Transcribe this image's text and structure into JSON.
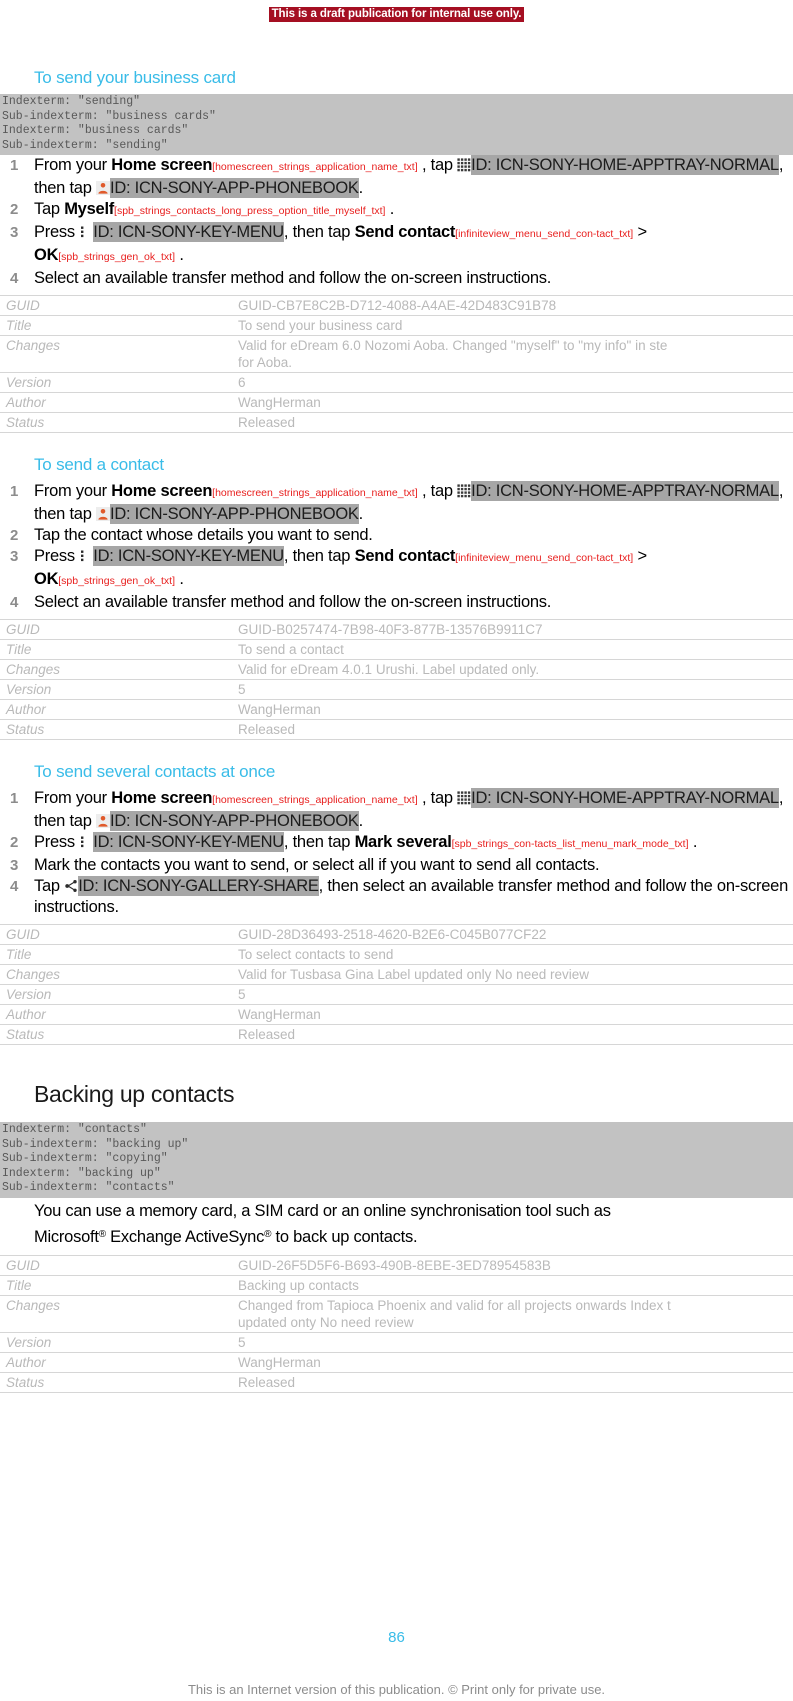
{
  "banner": {
    "text": "This is a draft publication for internal use only."
  },
  "colors": {
    "heading_blue": "#39bce8",
    "banner_red": "#a50f22",
    "token_red": "#e8201f",
    "idref_grey": "#a6a6a6",
    "indexblock_grey": "#c2c2c2",
    "meta_text_grey": "#b9b9b9"
  },
  "sections": [
    {
      "id": "send-business-card",
      "heading": "To send your business card",
      "indexterms": [
        "Indexterm: \"sending\"",
        "Sub-indexterm: \"business cards\"",
        "Indexterm: \"business cards\"",
        "Sub-indexterm: \"sending\""
      ],
      "steps": [
        {
          "num": "1",
          "parts": [
            {
              "t": "text",
              "v": "From your "
            },
            {
              "t": "bold",
              "v": "Home screen"
            },
            {
              "t": "token",
              "v": "[homescreen_strings_application_name_txt]"
            },
            {
              "t": "text",
              "v": " , tap "
            },
            {
              "t": "icon",
              "v": "apptray-grid-icon"
            },
            {
              "t": "idref",
              "v": "ID: ICN-SONY-HOME-APPTRAY-NORMAL"
            },
            {
              "t": "text",
              "v": ", then tap "
            },
            {
              "t": "icon",
              "v": "phonebook-person-icon"
            },
            {
              "t": "idref",
              "v": "ID: ICN-SONY-APP-PHONEBOOK"
            },
            {
              "t": "text",
              "v": "."
            }
          ]
        },
        {
          "num": "2",
          "parts": [
            {
              "t": "text",
              "v": "Tap "
            },
            {
              "t": "bold",
              "v": "Myself"
            },
            {
              "t": "token",
              "v": "[spb_strings_contacts_long_press_option_title_myself_txt]"
            },
            {
              "t": "text",
              "v": " ."
            }
          ]
        },
        {
          "num": "3",
          "parts": [
            {
              "t": "text",
              "v": "Press "
            },
            {
              "t": "icon",
              "v": "menu-key-icon"
            },
            {
              "t": "idref",
              "v": "ID: ICN-SONY-KEY-MENU"
            },
            {
              "t": "text",
              "v": ", then tap "
            },
            {
              "t": "bold",
              "v": "Send contact"
            },
            {
              "t": "token",
              "v": "[infiniteview_menu_send_con-tact_txt]"
            },
            {
              "t": "text",
              "v": " > "
            },
            {
              "t": "bold",
              "v": "OK"
            },
            {
              "t": "token",
              "v": "[spb_strings_gen_ok_txt]"
            },
            {
              "t": "text",
              "v": " ."
            }
          ]
        },
        {
          "num": "4",
          "parts": [
            {
              "t": "text",
              "v": "Select an available transfer method and follow the on-screen instructions."
            }
          ]
        }
      ],
      "meta": [
        {
          "key": "GUID",
          "value": "GUID-CB7E8C2B-D712-4088-A4AE-42D483C91B78",
          "clip": true
        },
        {
          "key": "Title",
          "value": "To send your business card",
          "clip": false
        },
        {
          "key": "Changes",
          "value": "Valid for eDream 6.0 Nozomi Aoba. Changed \"myself\" to \"my info\" in ste\nfor Aoba.",
          "clip": true
        },
        {
          "key": "Version",
          "value": "6",
          "clip": false
        },
        {
          "key": "Author",
          "value": "WangHerman",
          "clip": false
        },
        {
          "key": "Status",
          "value": "Released",
          "clip": false
        }
      ]
    },
    {
      "id": "send-a-contact",
      "heading": "To send a contact",
      "indexterms": [],
      "steps": [
        {
          "num": "1",
          "parts": [
            {
              "t": "text",
              "v": "From your "
            },
            {
              "t": "bold",
              "v": "Home screen"
            },
            {
              "t": "token",
              "v": "[homescreen_strings_application_name_txt]"
            },
            {
              "t": "text",
              "v": " , tap "
            },
            {
              "t": "icon",
              "v": "apptray-grid-icon"
            },
            {
              "t": "idref",
              "v": "ID: ICN-SONY-HOME-APPTRAY-NORMAL"
            },
            {
              "t": "text",
              "v": ", then tap "
            },
            {
              "t": "icon",
              "v": "phonebook-person-icon"
            },
            {
              "t": "idref",
              "v": "ID: ICN-SONY-APP-PHONEBOOK"
            },
            {
              "t": "text",
              "v": "."
            }
          ]
        },
        {
          "num": "2",
          "parts": [
            {
              "t": "text",
              "v": "Tap the contact whose details you want to send."
            }
          ]
        },
        {
          "num": "3",
          "parts": [
            {
              "t": "text",
              "v": "Press "
            },
            {
              "t": "icon",
              "v": "menu-key-icon"
            },
            {
              "t": "idref",
              "v": "ID: ICN-SONY-KEY-MENU"
            },
            {
              "t": "text",
              "v": ", then tap "
            },
            {
              "t": "bold",
              "v": "Send contact"
            },
            {
              "t": "token",
              "v": "[infiniteview_menu_send_con-tact_txt]"
            },
            {
              "t": "text",
              "v": " > "
            },
            {
              "t": "bold",
              "v": "OK"
            },
            {
              "t": "token",
              "v": "[spb_strings_gen_ok_txt]"
            },
            {
              "t": "text",
              "v": " ."
            }
          ]
        },
        {
          "num": "4",
          "parts": [
            {
              "t": "text",
              "v": "Select an available transfer method and follow the on-screen instructions."
            }
          ]
        }
      ],
      "meta": [
        {
          "key": "GUID",
          "value": "GUID-B0257474-7B98-40F3-877B-13576B9911C7",
          "clip": true
        },
        {
          "key": "Title",
          "value": "To send a contact",
          "clip": false
        },
        {
          "key": "Changes",
          "value": "Valid for eDream 4.0.1 Urushi. Label updated only.",
          "clip": false
        },
        {
          "key": "Version",
          "value": "5",
          "clip": false
        },
        {
          "key": "Author",
          "value": "WangHerman",
          "clip": false
        },
        {
          "key": "Status",
          "value": "Released",
          "clip": false
        }
      ]
    },
    {
      "id": "send-several-contacts",
      "heading": "To send several contacts at once",
      "indexterms": [],
      "steps": [
        {
          "num": "1",
          "parts": [
            {
              "t": "text",
              "v": "From your "
            },
            {
              "t": "bold",
              "v": "Home screen"
            },
            {
              "t": "token",
              "v": "[homescreen_strings_application_name_txt]"
            },
            {
              "t": "text",
              "v": " , tap "
            },
            {
              "t": "icon",
              "v": "apptray-grid-icon"
            },
            {
              "t": "idref",
              "v": "ID: ICN-SONY-HOME-APPTRAY-NORMAL"
            },
            {
              "t": "text",
              "v": ", then tap "
            },
            {
              "t": "icon",
              "v": "phonebook-person-icon"
            },
            {
              "t": "idref",
              "v": "ID: ICN-SONY-APP-PHONEBOOK"
            },
            {
              "t": "text",
              "v": "."
            }
          ]
        },
        {
          "num": "2",
          "parts": [
            {
              "t": "text",
              "v": "Press "
            },
            {
              "t": "icon",
              "v": "menu-key-icon"
            },
            {
              "t": "idref",
              "v": "ID: ICN-SONY-KEY-MENU"
            },
            {
              "t": "text",
              "v": ", then tap "
            },
            {
              "t": "bold",
              "v": "Mark several"
            },
            {
              "t": "token",
              "v": "[spb_strings_con-tacts_list_menu_mark_mode_txt]"
            },
            {
              "t": "text",
              "v": " ."
            }
          ]
        },
        {
          "num": "3",
          "parts": [
            {
              "t": "text",
              "v": "Mark the contacts you want to send, or select all if you want to send all contacts."
            }
          ]
        },
        {
          "num": "4",
          "parts": [
            {
              "t": "text",
              "v": "Tap "
            },
            {
              "t": "icon",
              "v": "share-icon"
            },
            {
              "t": "idref",
              "v": "ID: ICN-SONY-GALLERY-SHARE"
            },
            {
              "t": "text",
              "v": ", then select an available transfer method and follow the on-screen instructions."
            }
          ]
        }
      ],
      "meta": [
        {
          "key": "GUID",
          "value": "GUID-28D36493-2518-4620-B2E6-C045B077CF22",
          "clip": true
        },
        {
          "key": "Title",
          "value": "To select contacts to send",
          "clip": false
        },
        {
          "key": "Changes",
          "value": "Valid for Tusbasa Gina Label updated only No need review",
          "clip": false
        },
        {
          "key": "Version",
          "value": "5",
          "clip": false
        },
        {
          "key": "Author",
          "value": "WangHerman",
          "clip": false
        },
        {
          "key": "Status",
          "value": "Released",
          "clip": false
        }
      ]
    }
  ],
  "chapter": {
    "heading": "Backing up contacts",
    "indexterms": [
      "Indexterm: \"contacts\"",
      "Sub-indexterm: \"backing up\"",
      "Sub-indexterm: \"copying\"",
      "Indexterm: \"backing up\"",
      "Sub-indexterm: \"contacts\""
    ],
    "paragraph_line1": "You can use a memory card, a SIM card or an online synchronisation tool such as",
    "paragraph_line2_a": "Microsoft",
    "paragraph_line2_sup1": "®",
    "paragraph_line2_b": " Exchange ActiveSync",
    "paragraph_line2_sup2": "®",
    "paragraph_line2_c": " to back up contacts.",
    "meta": [
      {
        "key": "GUID",
        "value": "GUID-26F5D5F6-B693-490B-8EBE-3ED78954583B",
        "clip": true
      },
      {
        "key": "Title",
        "value": "Backing up contacts",
        "clip": false
      },
      {
        "key": "Changes",
        "value": "Changed from Tapioca Phoenix and valid for all projects onwards Index t\nupdated onty No need review",
        "clip": true
      },
      {
        "key": "Version",
        "value": "5",
        "clip": false
      },
      {
        "key": "Author",
        "value": "WangHerman",
        "clip": false
      },
      {
        "key": "Status",
        "value": "Released",
        "clip": false
      }
    ]
  },
  "footer": {
    "page_number": "86",
    "legal": "This is an Internet version of this publication. © Print only for private use."
  }
}
